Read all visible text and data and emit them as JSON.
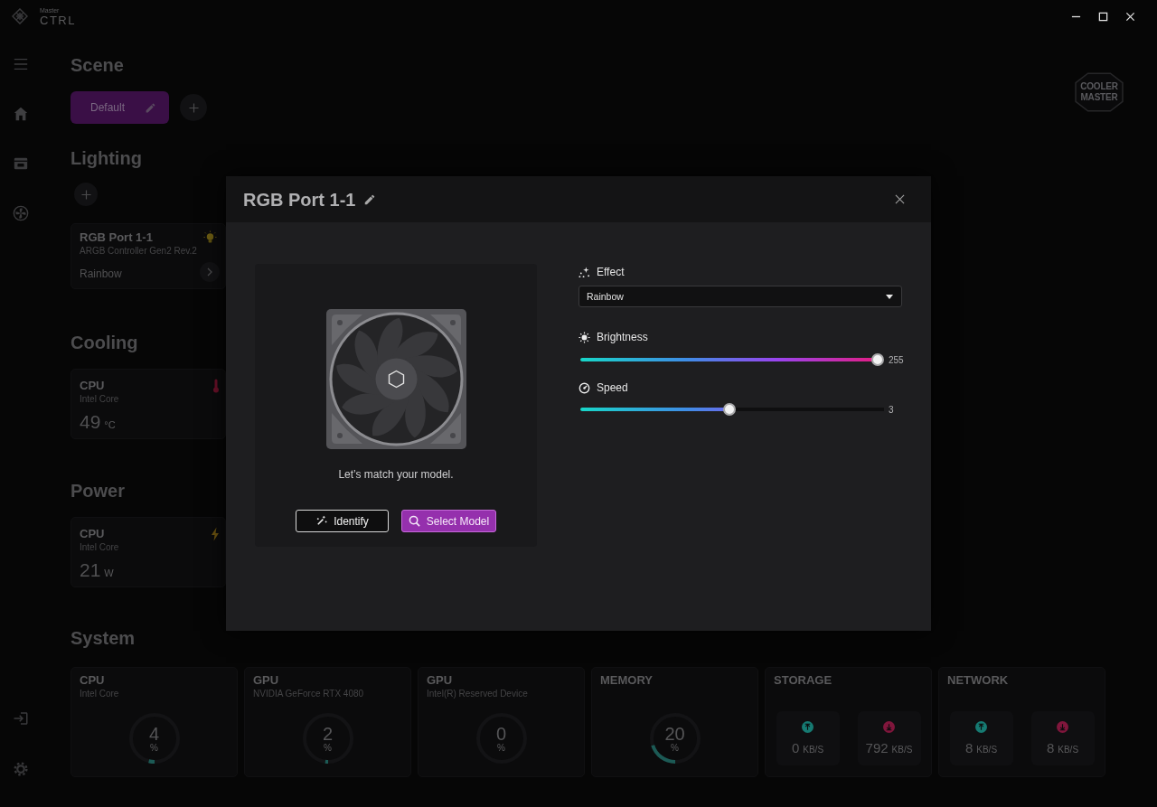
{
  "titlebar": {
    "logo": {
      "line_1": "Master",
      "line_2": "CTRL"
    }
  },
  "brand_logo": {
    "line_1": "COOLER",
    "line_2": "MASTER"
  },
  "scene": {
    "title": "Scene",
    "scenes": [
      {
        "label": "Default",
        "selected": true
      }
    ]
  },
  "lighting": {
    "title": "Lighting",
    "devices": [
      {
        "name": "RGB Port 1-1",
        "model": "ARGB Controller Gen2 Rev.2",
        "effect": "Rainbow"
      }
    ]
  },
  "cooling": {
    "title": "Cooling",
    "sensors": [
      {
        "name": "CPU",
        "model": "Intel Core",
        "value": "49",
        "unit": "°C"
      }
    ]
  },
  "power": {
    "title": "Power",
    "sensors": [
      {
        "name": "CPU",
        "model": "Intel Core",
        "value": "21",
        "unit": "W"
      }
    ]
  },
  "system": {
    "title": "System",
    "cards": [
      {
        "kind": "gauge",
        "name": "CPU",
        "model": "Intel Core",
        "value": "4",
        "unit": "%",
        "level": 0.04
      },
      {
        "kind": "gauge",
        "name": "GPU",
        "model": "NVIDIA GeForce RTX 4080",
        "value": "2",
        "unit": "%",
        "level": 0.02
      },
      {
        "kind": "gauge",
        "name": "GPU",
        "model": "Intel(R) Reserved Device",
        "value": "0",
        "unit": "%",
        "level": 0
      },
      {
        "kind": "gauge",
        "name": "MEMORY",
        "value": "20",
        "unit": "%",
        "level": 0.2
      },
      {
        "kind": "rates",
        "name": "STORAGE",
        "rates": [
          {
            "kind": "upload",
            "color": "#167a72",
            "value": "0",
            "unit": "KB/S"
          },
          {
            "kind": "download",
            "color": "#80163c",
            "value": "792",
            "unit": "KB/S"
          }
        ]
      },
      {
        "kind": "rates",
        "name": "NETWORK",
        "rates": [
          {
            "kind": "upload",
            "color": "#167a72",
            "value": "8",
            "unit": "KB/S"
          },
          {
            "kind": "download",
            "color": "#80163c",
            "value": "8",
            "unit": "KB/S"
          }
        ]
      }
    ]
  },
  "modal": {
    "title": "RGB Port 1-1",
    "preview": {
      "caption": "Let’s match your model.",
      "buttons": [
        {
          "kind": "outline",
          "label": "Identify"
        },
        {
          "kind": "primary",
          "label": "Select Model"
        }
      ]
    },
    "effect": {
      "label": "Effect",
      "value": "Rainbow"
    },
    "sliders": [
      {
        "kind": "brightness",
        "label": "Brightness",
        "level": 1,
        "reading": "255"
      },
      {
        "kind": "speed",
        "label": "Speed",
        "level": 0.49,
        "reading": "3"
      }
    ]
  }
}
